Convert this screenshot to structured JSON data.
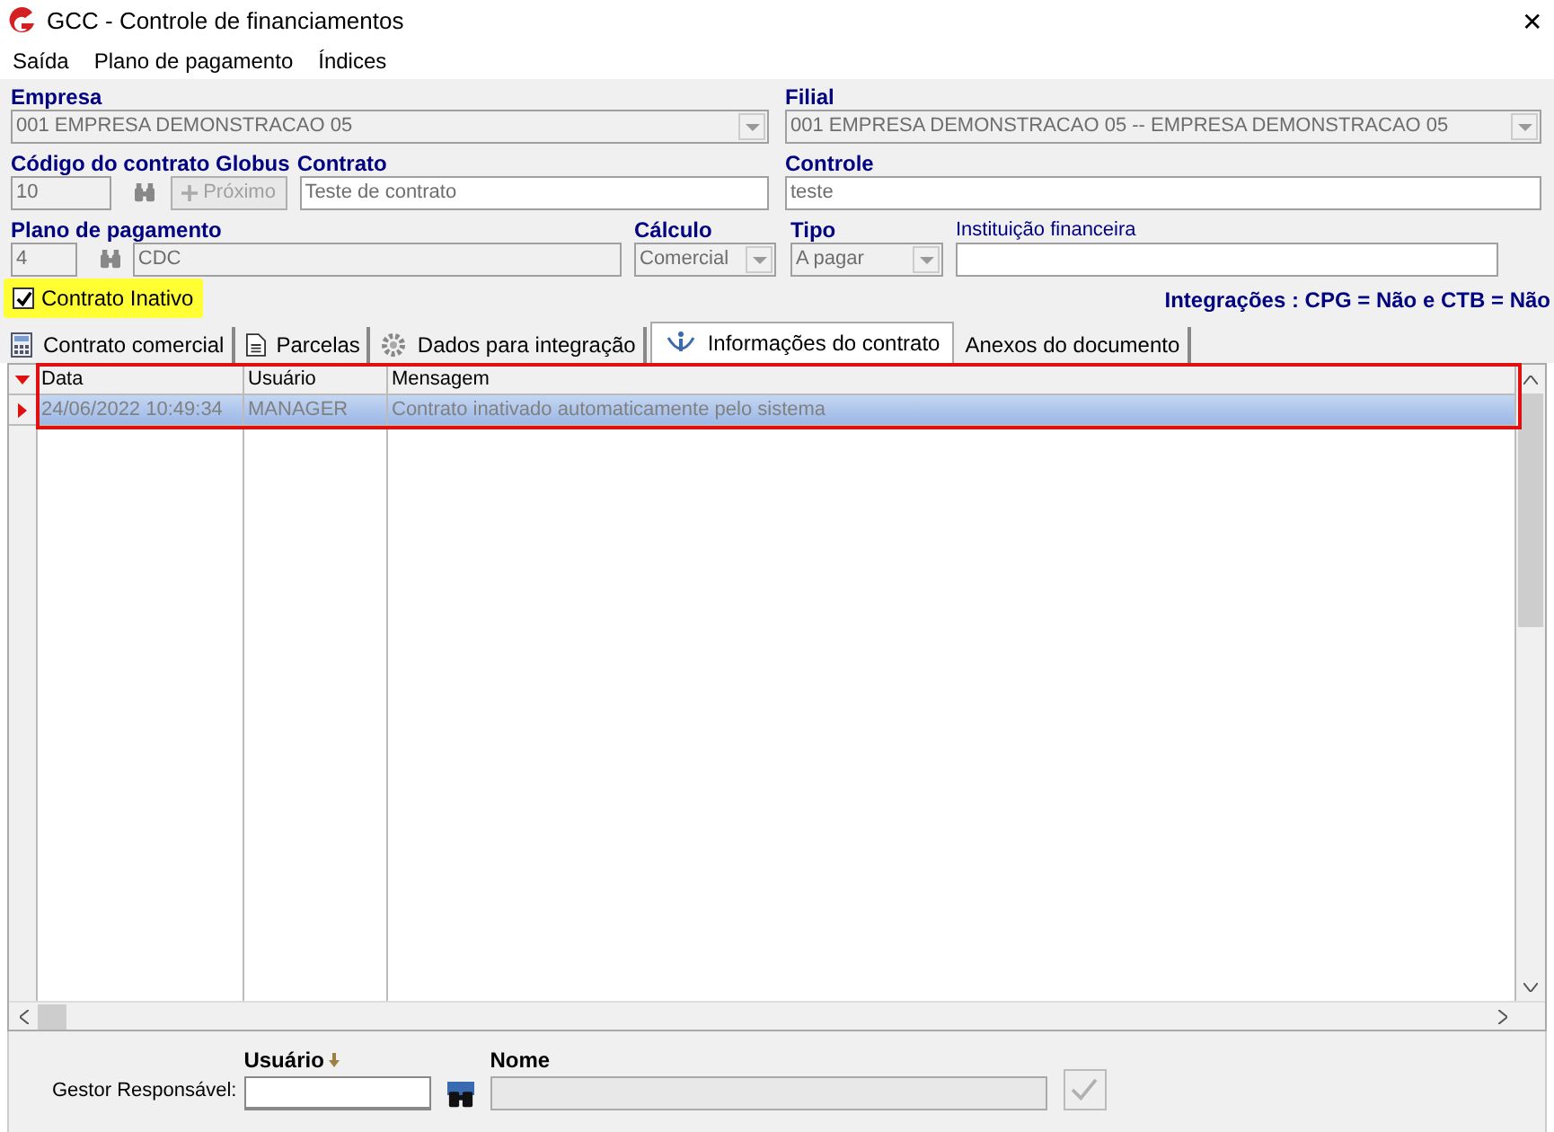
{
  "window": {
    "title": "GCC - Controle de financiamentos",
    "close": "✕"
  },
  "menu": [
    "Saída",
    "Plano de pagamento",
    "Índices"
  ],
  "form": {
    "empresa": {
      "label": "Empresa",
      "value": "001 EMPRESA DEMONSTRACAO 05"
    },
    "filial": {
      "label": "Filial",
      "value": "001 EMPRESA DEMONSTRACAO 05 -- EMPRESA DEMONSTRACAO 05"
    },
    "codigo": {
      "label": "Código do contrato Globus",
      "value": "10",
      "next_button": "Próximo"
    },
    "contrato": {
      "label": "Contrato",
      "value": "Teste de contrato"
    },
    "controle": {
      "label": "Controle",
      "value": "teste"
    },
    "plano": {
      "label": "Plano de pagamento",
      "code": "4",
      "value": "CDC"
    },
    "calculo": {
      "label": "Cálculo",
      "value": "Comercial"
    },
    "tipo": {
      "label": "Tipo",
      "value": "A pagar"
    },
    "instituicao": {
      "label": "Instituição financeira"
    },
    "inativo": {
      "label": "Contrato Inativo",
      "checked": true
    },
    "integracoes": "Integrações : CPG = Não e CTB = Não"
  },
  "tabs": [
    {
      "label": "Contrato comercial",
      "selected": false
    },
    {
      "label": "Parcelas",
      "selected": false
    },
    {
      "label": "Dados para integração",
      "selected": false
    },
    {
      "label": "Informações do contrato",
      "selected": true
    },
    {
      "label": "Anexos do documento",
      "selected": false
    }
  ],
  "grid": {
    "columns": [
      "Data",
      "Usuário",
      "Mensagem"
    ],
    "rows": [
      {
        "cells": [
          "24/06/2022 10:49:34",
          "MANAGER",
          "Contrato inativado automaticamente pelo sistema"
        ],
        "selected": true
      }
    ]
  },
  "footer": {
    "label": "Gestor Responsável:",
    "usuario_label": "Usuário",
    "nome_label": "Nome"
  }
}
